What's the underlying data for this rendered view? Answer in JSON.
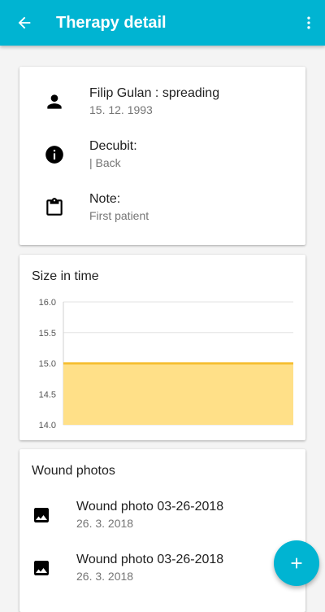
{
  "appbar": {
    "title": "Therapy detail",
    "back_icon": "arrow-back-icon",
    "more_icon": "more-vert-icon",
    "color": "#00b4d2"
  },
  "info": {
    "patient": {
      "icon": "person-icon",
      "name": "Filip Gulan : spreading",
      "date": "15. 12. 1993"
    },
    "decubit": {
      "icon": "info-icon",
      "label": "Decubit:",
      "value": "| Back"
    },
    "note": {
      "icon": "clipboard-icon",
      "label": "Note:",
      "value": "First patient"
    }
  },
  "size_card": {
    "title": "Size in time"
  },
  "chart_data": {
    "type": "area",
    "title": "Size in time",
    "xlabel": "",
    "ylabel": "",
    "x": [
      0,
      1
    ],
    "series": [
      {
        "values": [
          15.0,
          15.0
        ],
        "line_color": "#f5bc2a",
        "fill_color": "#ffe088"
      }
    ],
    "ylim": [
      14.0,
      16.0
    ],
    "yticks": [
      "14.0",
      "14.5",
      "15.0",
      "15.5",
      "16.0"
    ],
    "grid": true
  },
  "photos": {
    "title": "Wound photos",
    "items": [
      {
        "icon": "image-icon",
        "title": "Wound photo 03-26-2018",
        "date": "26. 3. 2018"
      },
      {
        "icon": "image-icon",
        "title": "Wound photo 03-26-2018",
        "date": "26. 3. 2018"
      }
    ]
  },
  "fab": {
    "icon": "plus-icon"
  }
}
